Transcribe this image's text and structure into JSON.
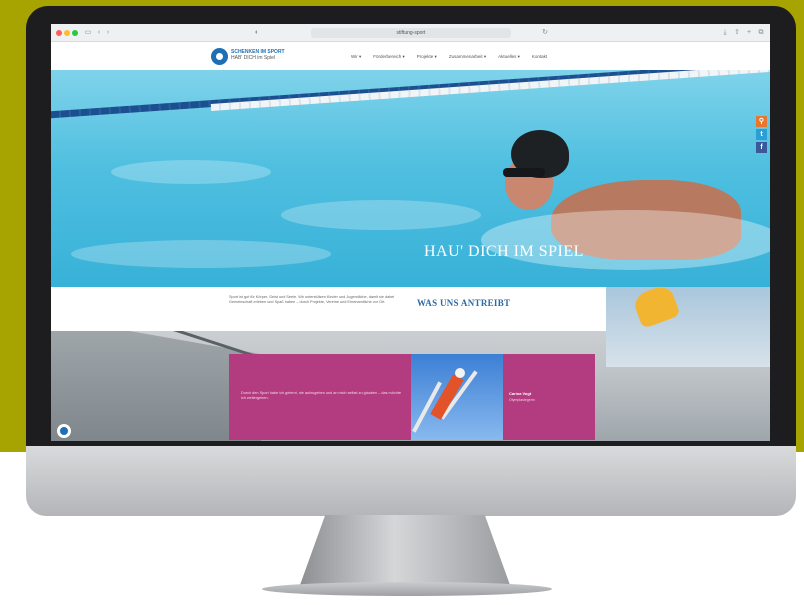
{
  "browser": {
    "url": "stiftung-sport",
    "tab_icon": "page-icon"
  },
  "site": {
    "logo_text": "SCHENKEN IM SPORT",
    "logo_subtext": "HAB' DICH im Spiel",
    "menu": [
      "Wir ▾",
      "Förderbereich ▾",
      "Projekte ▾",
      "Zusammenarbeit ▾",
      "Aktuelles ▾",
      "Kontakt"
    ]
  },
  "hero": {
    "title": "HAU' DICH IM SPIEL"
  },
  "intro": {
    "text": "Sport ist gut für Körper, Geist und Seele. Wir unterstützen Kinder und Jugendliche, damit sie dabei Gemeinschaft erleben und Spaß haben – durch Projekte, Vereine und Ehrenamtliche vor Ort.",
    "heading": "WAS UNS ANTREIBT"
  },
  "quote": {
    "text": "Durch den Sport habe ich gelernt, nie aufzugeben und an mich selbst zu glauben – das möchte ich weitergeben.",
    "name": "Carina Vogt",
    "role": "Olympiasiegerin"
  },
  "social": {
    "items": [
      {
        "icon": "search-icon",
        "glyph": "⚲",
        "color": "#e6772e"
      },
      {
        "icon": "twitter-icon",
        "glyph": "t",
        "color": "#2a9fd6"
      },
      {
        "icon": "facebook-icon",
        "glyph": "f",
        "color": "#3b5998"
      }
    ]
  },
  "colors": {
    "accent_blue": "#1f6fb5",
    "quote_pink": "#b33b7f",
    "background_olive": "#a7a300"
  }
}
